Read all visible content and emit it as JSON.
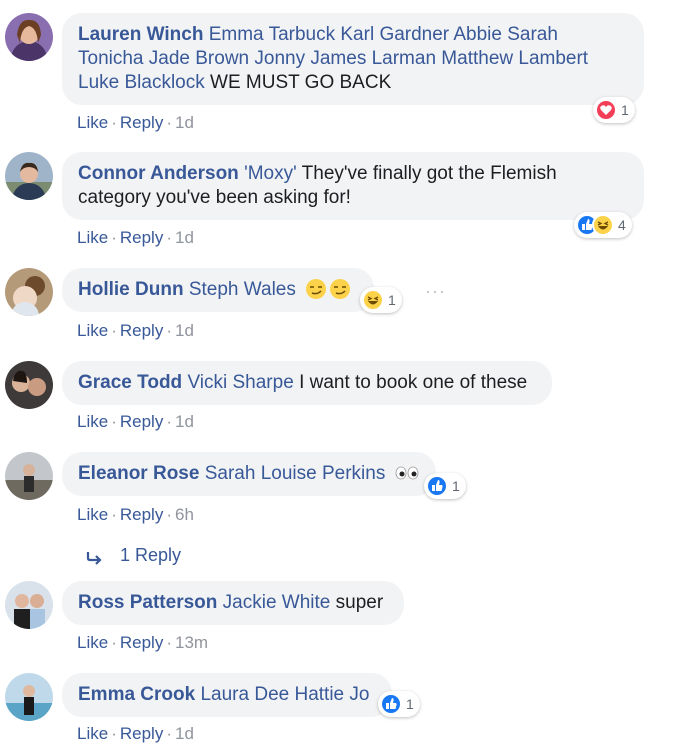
{
  "comments": [
    {
      "author": "Lauren Winch",
      "mentions": "Emma Tarbuck Karl Gardner Abbie Sarah Tonicha Jade Brown Jonny James Larman Matthew Lambert Luke Blacklock",
      "text": "WE MUST GO BACK",
      "like": "Like",
      "reply": "Reply",
      "time": "1d",
      "reaction_count": "1",
      "reaction_icons": [
        "heart-icon"
      ]
    },
    {
      "author": "Connor Anderson",
      "mentions": "'Moxy'",
      "text": "They've finally got the Flemish category you've been asking for!",
      "like": "Like",
      "reply": "Reply",
      "time": "1d",
      "reaction_count": "4",
      "reaction_icons": [
        "thumbs-up-icon",
        "laughing-emoji-icon"
      ]
    },
    {
      "author": "Hollie Dunn",
      "mentions": "Steph Wales",
      "text": "",
      "like": "Like",
      "reply": "Reply",
      "time": "1d",
      "reaction_count": "1",
      "reaction_icons": [
        "laughing-emoji-icon"
      ]
    },
    {
      "author": "Grace Todd",
      "mentions": "Vicki Sharpe",
      "text": "I want to book one of these",
      "like": "Like",
      "reply": "Reply",
      "time": "1d"
    },
    {
      "author": "Eleanor Rose",
      "mentions": "Sarah Louise Perkins",
      "text": "",
      "like": "Like",
      "reply": "Reply",
      "time": "6h",
      "reaction_count": "1",
      "reaction_icons": [
        "thumbs-up-icon"
      ]
    },
    {
      "author": "Ross Patterson",
      "mentions": "Jackie White",
      "text": "super",
      "like": "Like",
      "reply": "Reply",
      "time": "13m"
    },
    {
      "author": "Emma Crook",
      "mentions": "Laura Dee Hattie Jo",
      "text": "",
      "like": "Like",
      "reply": "Reply",
      "time": "1d",
      "reaction_count": "1",
      "reaction_icons": [
        "thumbs-up-icon"
      ]
    }
  ],
  "replies_link": "1 Reply",
  "more_options": "···",
  "colors": {
    "link": "#385898",
    "bubble": "#f2f3f5",
    "like_blue": "#1877f2",
    "love_red": "#f33e58",
    "emoji_yellow": "#fbd24a"
  }
}
